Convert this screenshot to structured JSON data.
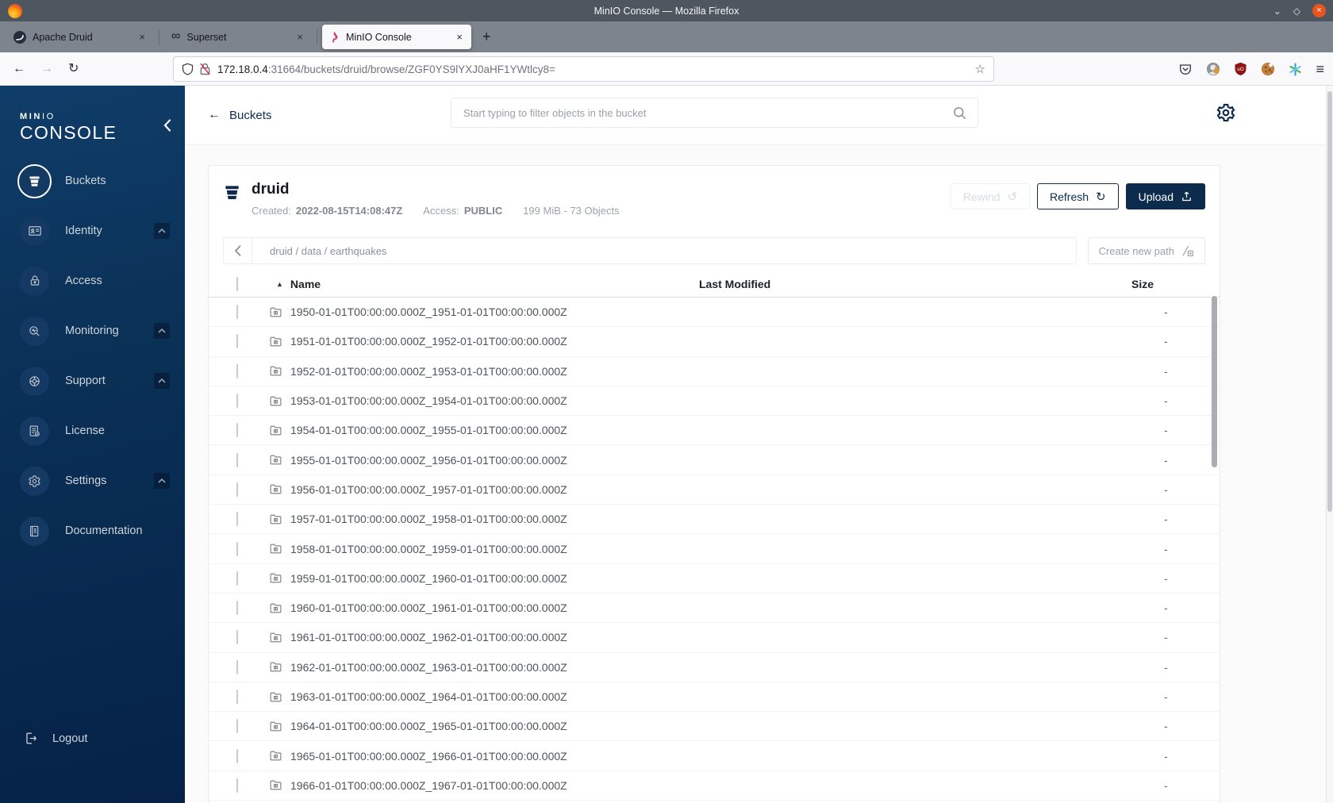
{
  "window": {
    "title": "MinIO Console — Mozilla Firefox"
  },
  "browser_tabs": [
    {
      "label": "Apache Druid"
    },
    {
      "label": "Superset"
    },
    {
      "label": "MinIO Console",
      "active": true
    }
  ],
  "urlbar": {
    "host": "172.18.0.4",
    "rest": ":31664/buckets/druid/browse/ZGF0YS9lYXJ0aHF1YWtlcy8="
  },
  "glyphs": {
    "back": "←",
    "forward": "→",
    "reload": "↻",
    "rewind": "↺",
    "sort_asc": "▲",
    "star": "☆",
    "infinity": "∞",
    "menu": "≡",
    "close": "×",
    "new_tab": "+",
    "minimize": "⌄",
    "maximize": "◇",
    "window_close": "×"
  },
  "sidebar": {
    "logo": {
      "bold": "MIN",
      "light": "IO",
      "sub": "CONSOLE"
    },
    "items": [
      {
        "label": "Buckets",
        "active": true,
        "expandable": false
      },
      {
        "label": "Identity",
        "active": false,
        "expandable": true
      },
      {
        "label": "Access",
        "active": false,
        "expandable": false
      },
      {
        "label": "Monitoring",
        "active": false,
        "expandable": true
      },
      {
        "label": "Support",
        "active": false,
        "expandable": true
      },
      {
        "label": "License",
        "active": false,
        "expandable": false
      },
      {
        "label": "Settings",
        "active": false,
        "expandable": true
      },
      {
        "label": "Documentation",
        "active": false,
        "expandable": false
      }
    ],
    "logout_label": "Logout"
  },
  "header": {
    "back_label": "Buckets",
    "search_placeholder": "Start typing to filter objects in the bucket"
  },
  "bucket": {
    "name": "druid",
    "created_label": "Created:",
    "created_value": "2022-08-15T14:08:47Z",
    "access_label": "Access:",
    "access_value": "PUBLIC",
    "usage": "199 MiB - 73 Objects",
    "buttons": {
      "rewind": "Rewind",
      "refresh": "Refresh",
      "upload": "Upload"
    }
  },
  "path_bar": {
    "breadcrumb": "druid / data / earthquakes",
    "create_path_label": "Create new path"
  },
  "table": {
    "columns": {
      "name": "Name",
      "last_modified": "Last Modified",
      "size": "Size"
    },
    "rows": [
      {
        "name": "1950-01-01T00:00:00.000Z_1951-01-01T00:00:00.000Z",
        "size": "-"
      },
      {
        "name": "1951-01-01T00:00:00.000Z_1952-01-01T00:00:00.000Z",
        "size": "-"
      },
      {
        "name": "1952-01-01T00:00:00.000Z_1953-01-01T00:00:00.000Z",
        "size": "-"
      },
      {
        "name": "1953-01-01T00:00:00.000Z_1954-01-01T00:00:00.000Z",
        "size": "-"
      },
      {
        "name": "1954-01-01T00:00:00.000Z_1955-01-01T00:00:00.000Z",
        "size": "-"
      },
      {
        "name": "1955-01-01T00:00:00.000Z_1956-01-01T00:00:00.000Z",
        "size": "-"
      },
      {
        "name": "1956-01-01T00:00:00.000Z_1957-01-01T00:00:00.000Z",
        "size": "-"
      },
      {
        "name": "1957-01-01T00:00:00.000Z_1958-01-01T00:00:00.000Z",
        "size": "-"
      },
      {
        "name": "1958-01-01T00:00:00.000Z_1959-01-01T00:00:00.000Z",
        "size": "-"
      },
      {
        "name": "1959-01-01T00:00:00.000Z_1960-01-01T00:00:00.000Z",
        "size": "-"
      },
      {
        "name": "1960-01-01T00:00:00.000Z_1961-01-01T00:00:00.000Z",
        "size": "-"
      },
      {
        "name": "1961-01-01T00:00:00.000Z_1962-01-01T00:00:00.000Z",
        "size": "-"
      },
      {
        "name": "1962-01-01T00:00:00.000Z_1963-01-01T00:00:00.000Z",
        "size": "-"
      },
      {
        "name": "1963-01-01T00:00:00.000Z_1964-01-01T00:00:00.000Z",
        "size": "-"
      },
      {
        "name": "1964-01-01T00:00:00.000Z_1965-01-01T00:00:00.000Z",
        "size": "-"
      },
      {
        "name": "1965-01-01T00:00:00.000Z_1966-01-01T00:00:00.000Z",
        "size": "-"
      },
      {
        "name": "1966-01-01T00:00:00.000Z_1967-01-01T00:00:00.000Z",
        "size": "-"
      }
    ]
  },
  "colors": {
    "accent_navy": "#0c2b4d",
    "sidebar_gradient_top": "#0f3d69",
    "sidebar_gradient_bottom": "#062248",
    "titlebar": "#4e575f",
    "close_button": "#e9541f"
  }
}
